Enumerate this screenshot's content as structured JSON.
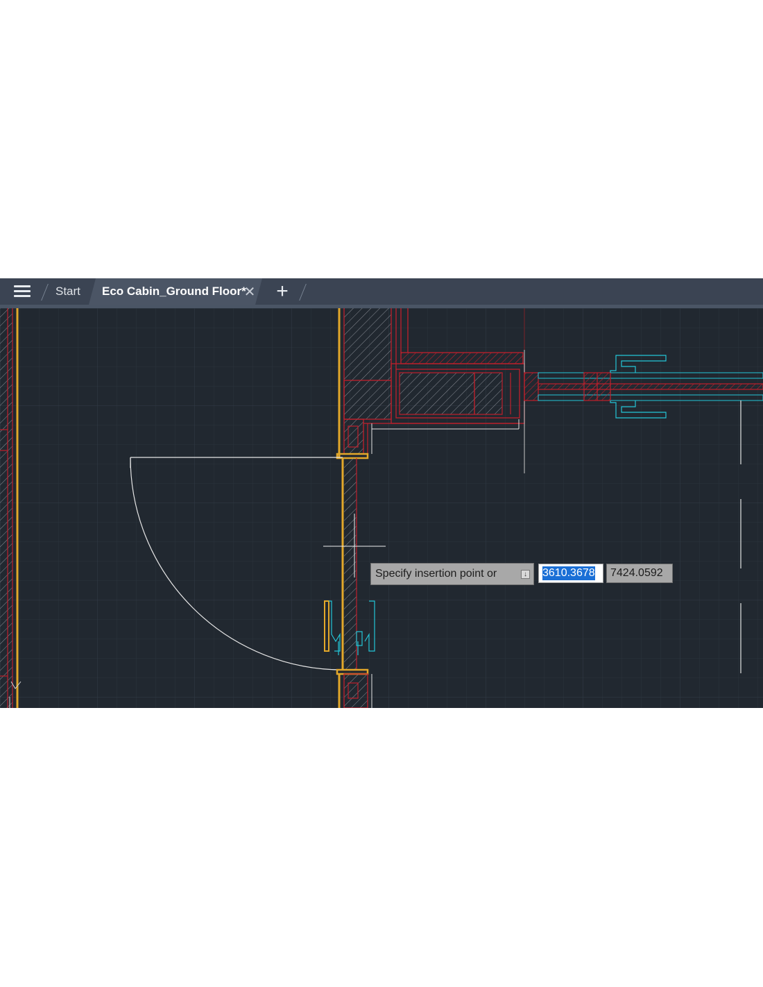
{
  "tabs": {
    "menu_icon": "hamburger-menu-icon",
    "start_label": "Start",
    "active_label": "Eco Cabin_Ground Floor*",
    "close_glyph": "✕",
    "new_tab_glyph": "+"
  },
  "command": {
    "prompt_text": "Specify insertion point or",
    "dropdown_icon": "down-arrow-icon",
    "x_value": "3610.3678",
    "y_value": "7424.0592"
  },
  "colors": {
    "background": "#212830",
    "tabbar": "#3b4453",
    "wall_hatch": "#c0202c",
    "door_frame": "#e3a82a",
    "hardware": "#24c6d8",
    "door_swing": "#e6e6e6"
  }
}
